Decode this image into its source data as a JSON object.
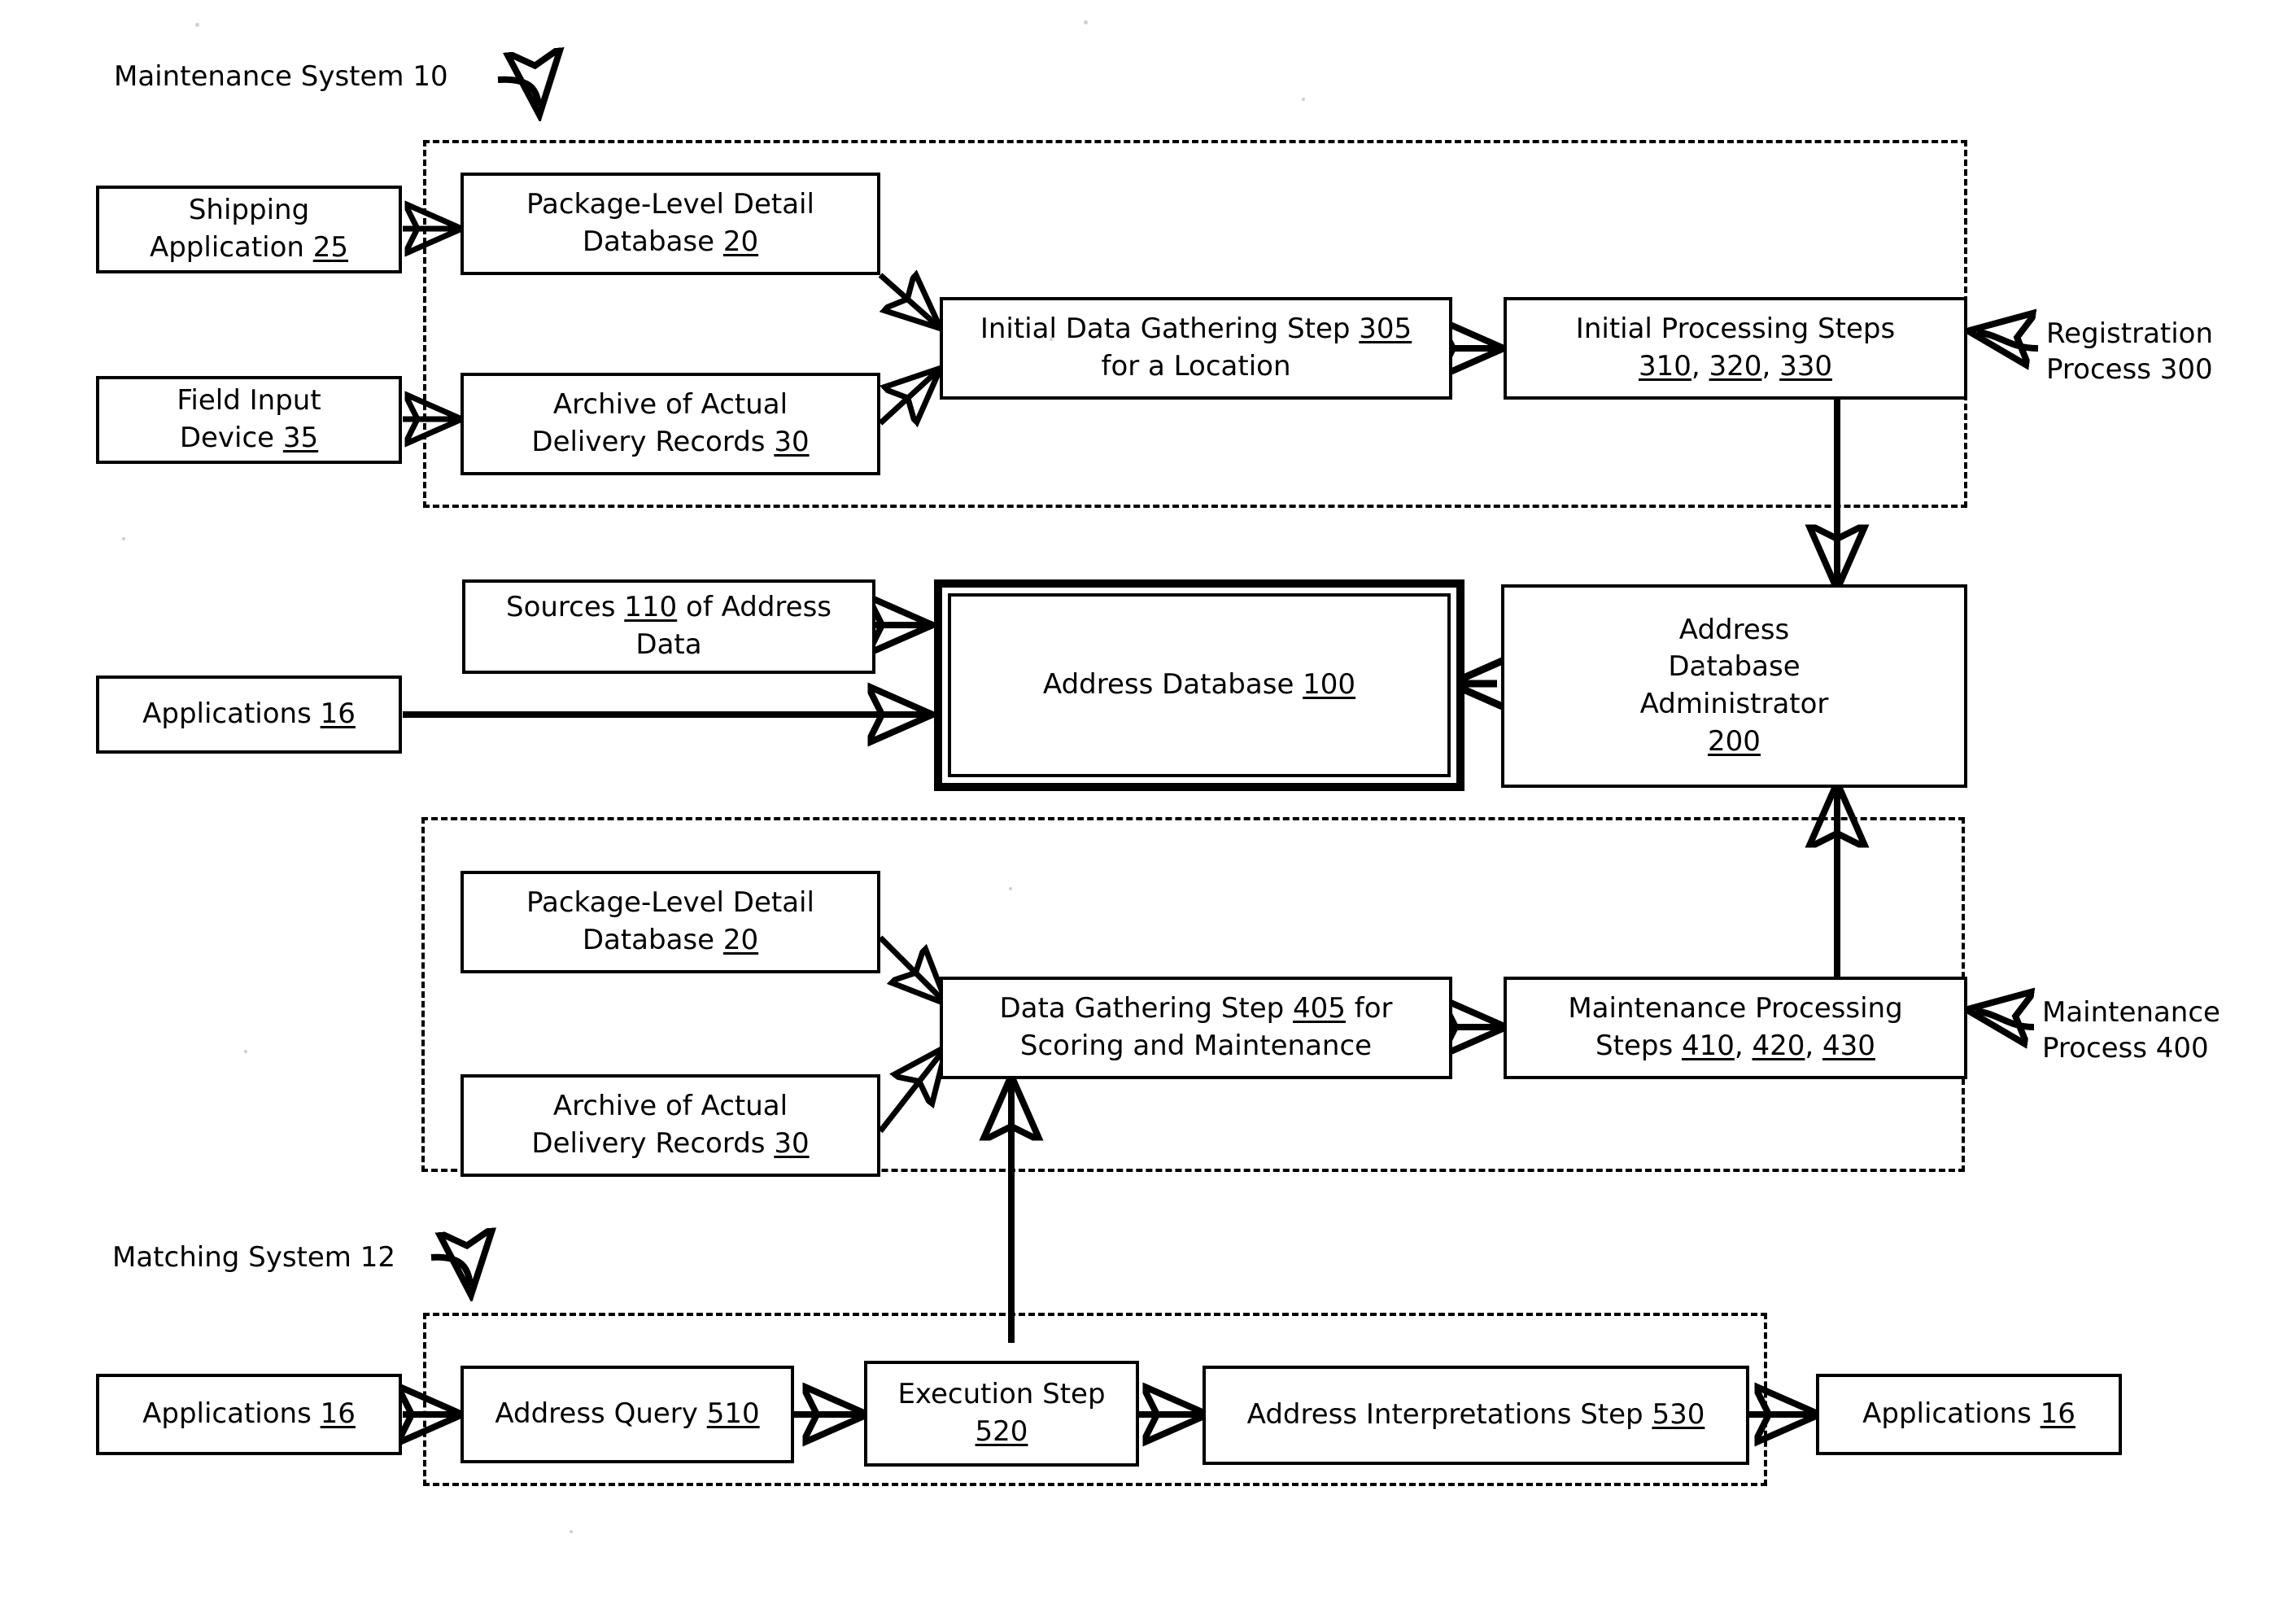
{
  "figure": {
    "type": "patent-block-diagram",
    "annotations": [
      {
        "id": "maintenance-system",
        "text": "Maintenance System 10"
      },
      {
        "id": "registration-process",
        "text": "Registration\nProcess 300"
      },
      {
        "id": "maintenance-process",
        "text": "Maintenance\nProcess 400"
      },
      {
        "id": "matching-system",
        "text": "Matching System 12"
      }
    ]
  },
  "boxes": {
    "shipping_application": {
      "line1": "Shipping",
      "line2": "Application ",
      "ref": "25"
    },
    "field_input_device": {
      "line1": "Field Input",
      "line2": "Device ",
      "ref": "35"
    },
    "pld_database_top": {
      "line1": "Package-Level Detail",
      "line2": "Database ",
      "ref": "20"
    },
    "archive_top": {
      "line1": "Archive of Actual",
      "line2": "Delivery Records ",
      "ref": "30"
    },
    "initial_data_gathering": {
      "line1": "Initial Data Gathering Step ",
      "ref": "305",
      "line2": "for a Location"
    },
    "initial_processing": {
      "line1": "Initial Processing Steps",
      "ref1": "310",
      "ref2": "320",
      "ref3": "330"
    },
    "sources_of_address_data": {
      "pre": "Sources ",
      "ref": "110",
      "post": " of Address",
      "line2": "Data"
    },
    "applications_left": {
      "text": "Applications ",
      "ref": "16"
    },
    "address_database": {
      "line1": "Address",
      "line2": "Database",
      "ref": "100"
    },
    "address_database_admin": {
      "line1": "Address",
      "line2": "Database",
      "line3": "Administrator",
      "ref": "200"
    },
    "pld_database_mid": {
      "line1": "Package-Level Detail",
      "line2": "Database ",
      "ref": "20"
    },
    "archive_mid": {
      "line1": "Archive of Actual",
      "line2": "Delivery Records ",
      "ref": "30"
    },
    "data_gathering_405": {
      "pre": "Data Gathering Step ",
      "ref": "405",
      "post": " for",
      "line2": "Scoring and Maintenance"
    },
    "maintenance_processing": {
      "line1": "Maintenance Processing",
      "pre2": "Steps ",
      "ref1": "410",
      "ref2": "420",
      "ref3": "430"
    },
    "applications_bottom_left": {
      "text": "Applications ",
      "ref": "16"
    },
    "address_query": {
      "text": "Address Query ",
      "ref": "510"
    },
    "execution_step": {
      "line1": "Execution Step",
      "ref": "520"
    },
    "address_interpretations": {
      "text": "Address Interpretations Step ",
      "ref": "530"
    },
    "applications_bottom_right": {
      "text": "Applications ",
      "ref": "16"
    }
  },
  "colors": {
    "stroke": "#000000",
    "background": "#ffffff"
  }
}
